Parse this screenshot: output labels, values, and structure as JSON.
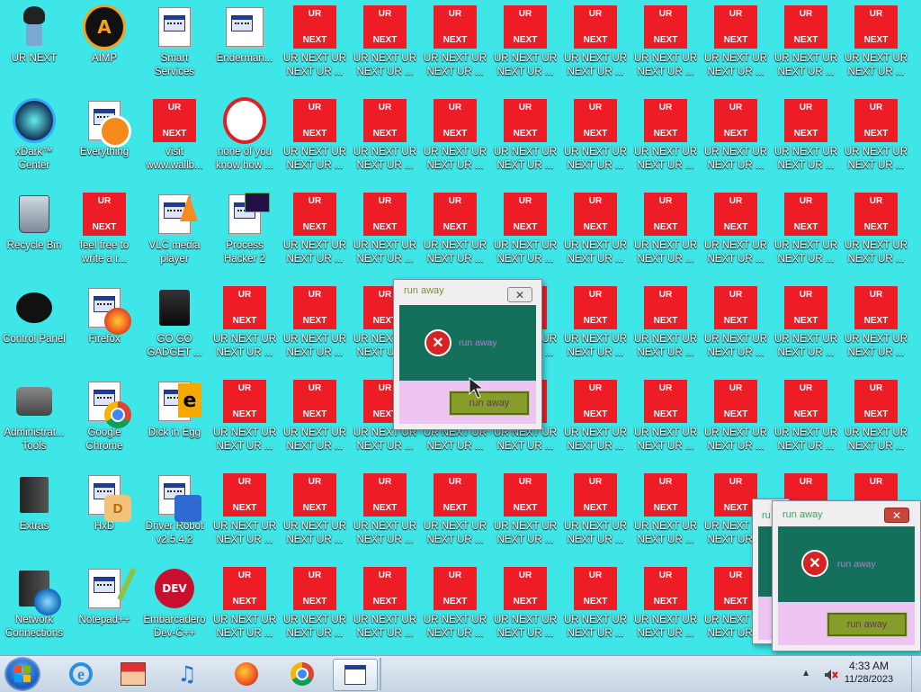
{
  "desktop": {
    "named_icons": [
      {
        "label": "UR NEXT",
        "icon": "anime-character-icon"
      },
      {
        "label": "AIMP",
        "icon": "aimp-logo-icon"
      },
      {
        "label": "Smart Services",
        "icon": "smart-services-icon"
      },
      {
        "label": "Enderman...",
        "icon": "executable-window-icon"
      },
      {
        "label": "xDark™ Center",
        "icon": "xdark-center-icon"
      },
      {
        "label": "Everything",
        "icon": "everything-search-icon"
      },
      {
        "label": "visit www.wallb...",
        "icon": "ur-next-icon"
      },
      {
        "label": "none of you know how ...",
        "icon": "none-of-you-icon"
      },
      {
        "label": "Recycle Bin",
        "icon": "recycle-bin-icon"
      },
      {
        "label": "feel free to write a r...",
        "icon": "ur-next-icon"
      },
      {
        "label": "VLC media player",
        "icon": "vlc-cone-icon"
      },
      {
        "label": "Process Hacker 2",
        "icon": "process-hacker-icon"
      },
      {
        "label": "Control Panel",
        "icon": "control-panel-icon"
      },
      {
        "label": "Firefox",
        "icon": "firefox-icon"
      },
      {
        "label": "GO GO GADGET ...",
        "icon": "gadget-folder-icon"
      },
      {
        "label": "Administrat... Tools",
        "icon": "admin-tools-icon"
      },
      {
        "label": "Google Chrome",
        "icon": "chrome-icon"
      },
      {
        "label": "Dick in Egg",
        "icon": "dick-in-egg-icon"
      },
      {
        "label": "Extras",
        "icon": "extras-folder-icon"
      },
      {
        "label": "HxD",
        "icon": "hxd-hex-editor-icon"
      },
      {
        "label": "Driver Robot v2.5.4.2",
        "icon": "driver-robot-icon"
      },
      {
        "label": "Network Connections",
        "icon": "network-globe-icon"
      },
      {
        "label": "Notepad++",
        "icon": "notepadpp-icon"
      },
      {
        "label": "Embarcadero Dev-C++",
        "icon": "devcpp-icon"
      }
    ],
    "ur_next_icon": {
      "tile_top": "UR",
      "tile_bottom": "NEXT",
      "label": "UR NEXT UR NEXT UR ..."
    }
  },
  "dialogs": {
    "main": {
      "title": "run away",
      "message": "run away",
      "button": "run away",
      "close_glyph": "✕"
    },
    "front": {
      "title": "run away",
      "message": "run away",
      "button": "run away",
      "close_glyph": "✕"
    },
    "back": {
      "title": "ru"
    }
  },
  "taskbar": {
    "apps": [
      "internet-explorer-icon",
      "store-icon",
      "music-note-icon",
      "firefox-icon",
      "chrome-icon",
      "generic-app-icon"
    ],
    "clock": {
      "time": "4:33 AM",
      "date": "11/28/2023"
    },
    "tray_arrow": "▲"
  },
  "colors": {
    "desktop_bg": "#3ee6e8",
    "ur_tile": "#ee1c25",
    "dialog_body": "#14705a",
    "dialog_footer": "#eec4f3",
    "dialog_button": "#879d2b",
    "dialog_message": "#b77bd0"
  }
}
